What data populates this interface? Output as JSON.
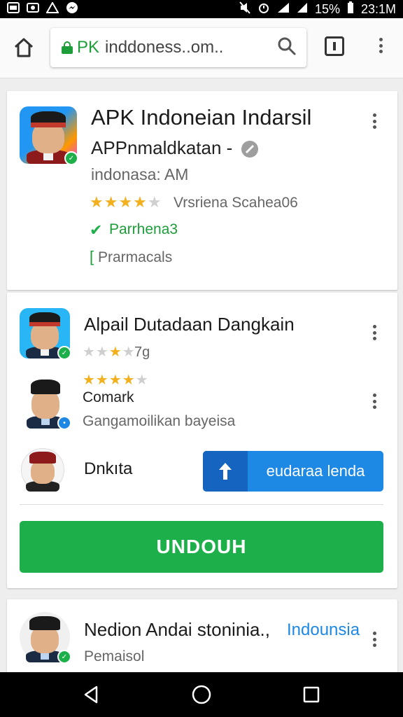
{
  "status_bar": {
    "battery": "15%",
    "time": "23:1M"
  },
  "browser": {
    "url_secure": "PK",
    "url_text": "inddoness..om.."
  },
  "main_card": {
    "title": "APK Indoneian Indarsil",
    "subtitle": "APPnmaldkatan -",
    "meta": "indonasa: AM",
    "rating": {
      "value": 4,
      "max": 5
    },
    "rating_text": "Vrsriena Scahea06",
    "verified": "Parrhena3",
    "bracket_text": "Prarmacals"
  },
  "related_card": {
    "item1": {
      "title": "Alpail Dutadaan Dangkain",
      "rating": {
        "value": 3,
        "max": 5
      },
      "rating_text": "7g"
    },
    "item2": {
      "rating": {
        "value": 4,
        "max": 5
      },
      "name": "Comark",
      "desc": "Gangamoilikan bayeisa"
    },
    "item3": {
      "name": "Dnkıta"
    },
    "update_label": "eudaraa lenda",
    "download_label": "UNDOUH"
  },
  "bottom_card": {
    "title": "Nedion Andai stoninia.,",
    "link": "Indounsia",
    "subtitle": "Pemaisol"
  },
  "colors": {
    "accent_green": "#1db04a",
    "accent_blue": "#1e88e5",
    "secure_green": "#1e9e3a",
    "star": "#f2b01e"
  }
}
